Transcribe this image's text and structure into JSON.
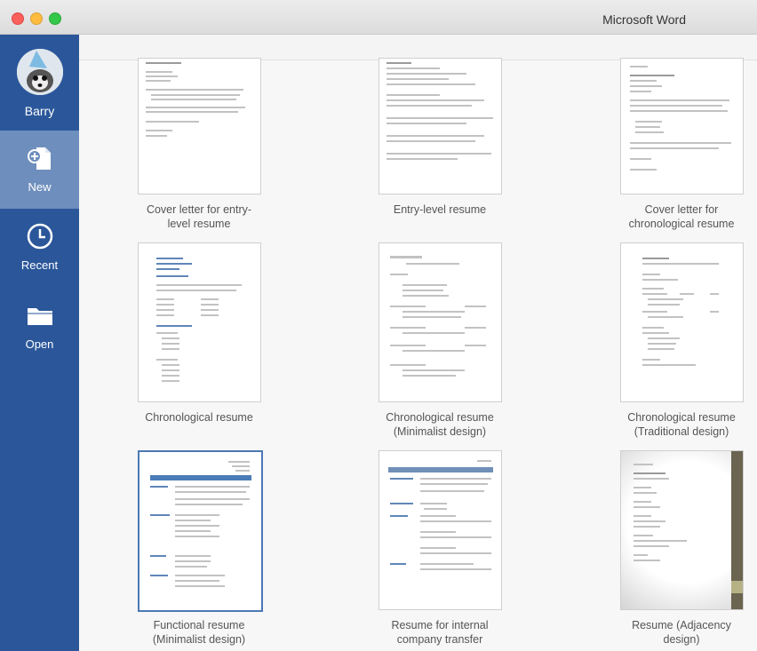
{
  "window": {
    "title": "Microsoft Word"
  },
  "sidebar": {
    "user": "Barry",
    "items": [
      {
        "label": "New",
        "icon": "new-document-icon",
        "active": true
      },
      {
        "label": "Recent",
        "icon": "clock-icon",
        "active": false
      },
      {
        "label": "Open",
        "icon": "folder-icon",
        "active": false
      }
    ]
  },
  "templates": [
    {
      "line1": "Cover letter for entry-",
      "line2": "level resume"
    },
    {
      "line1": "Entry-level resume",
      "line2": ""
    },
    {
      "line1": "Cover letter for",
      "line2": "chronological resume"
    },
    {
      "line1": "Chronological resume",
      "line2": ""
    },
    {
      "line1": "Chronological resume",
      "line2": "(Minimalist design)"
    },
    {
      "line1": "Chronological resume",
      "line2": "(Traditional design)"
    },
    {
      "line1": "Functional resume",
      "line2": "(Minimalist design)"
    },
    {
      "line1": "Resume for internal",
      "line2": "company transfer"
    },
    {
      "line1": "Resume (Adjacency",
      "line2": "design)"
    }
  ],
  "colors": {
    "sidebar": "#2b579a",
    "sidebar_active": "#6e8fbd",
    "selection": "#4c78b4"
  }
}
